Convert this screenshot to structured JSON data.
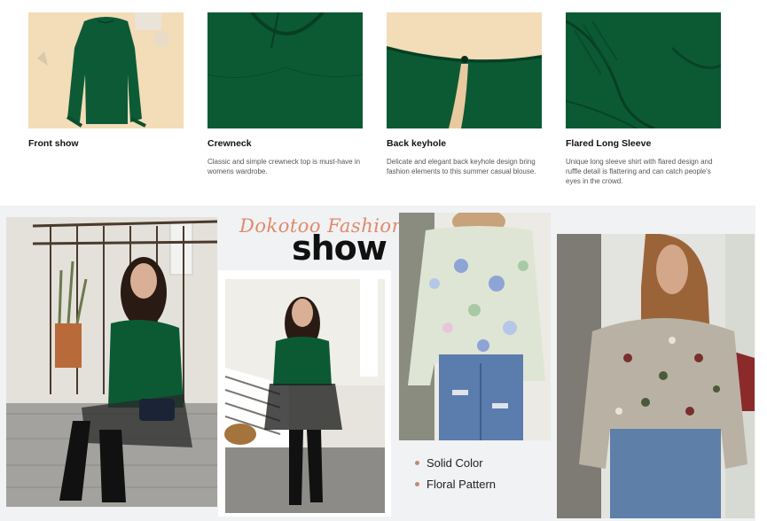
{
  "features": [
    {
      "title": "Front show",
      "desc": ""
    },
    {
      "title": "Crewneck",
      "desc": "Classic and simple crewneck top is must-have in womens wardrobe."
    },
    {
      "title": "Back keyhole",
      "desc": "Delicate and elegant back keyhole design bring fashion elements to this summer casual blouse."
    },
    {
      "title": "Flared Long Sleeve",
      "desc": "Unique long sleeve shirt with flared design and ruffle detail is flattering and can catch people's eyes in the crowd."
    }
  ],
  "brand": {
    "script": "Dokotoo Fashion",
    "show": "show"
  },
  "variants": [
    "Solid Color",
    "Floral Pattern"
  ],
  "colors": {
    "green": "#0c5a34",
    "beige": "#f3dcb8",
    "accent": "#c38a6c"
  }
}
